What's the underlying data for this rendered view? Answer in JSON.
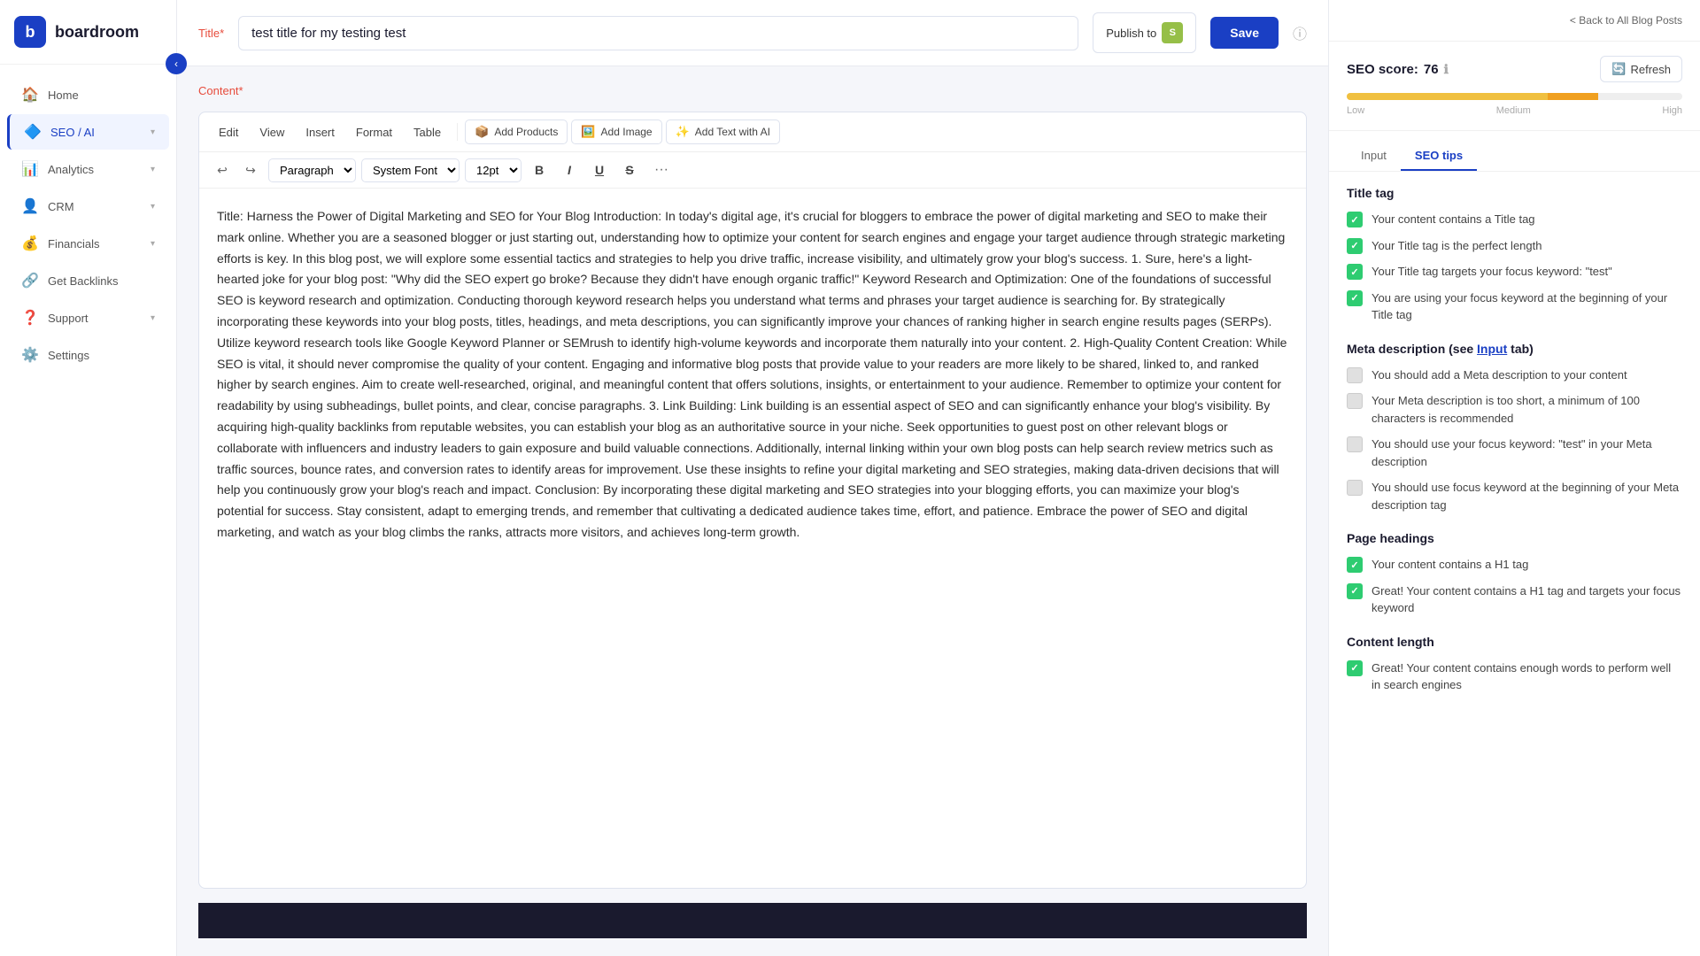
{
  "sidebar": {
    "logo_initial": "b",
    "logo_name": "boardroom",
    "nav_items": [
      {
        "id": "home",
        "label": "Home",
        "icon": "🏠",
        "active": false
      },
      {
        "id": "seo-ai",
        "label": "SEO / AI",
        "icon": "🔷",
        "active": true,
        "has_chevron": true
      },
      {
        "id": "analytics",
        "label": "Analytics",
        "icon": "📊",
        "active": false,
        "has_chevron": true
      },
      {
        "id": "crm",
        "label": "CRM",
        "icon": "👤",
        "active": false,
        "has_chevron": true
      },
      {
        "id": "financials",
        "label": "Financials",
        "icon": "💰",
        "active": false,
        "has_chevron": true
      },
      {
        "id": "backlinks",
        "label": "Get Backlinks",
        "icon": "🔗",
        "active": false
      },
      {
        "id": "support",
        "label": "Support",
        "icon": "❓",
        "active": false,
        "has_chevron": true
      },
      {
        "id": "settings",
        "label": "Settings",
        "icon": "⚙️",
        "active": false
      }
    ]
  },
  "top_bar": {
    "title_label": "Title*",
    "title_value": "test title for my testing test",
    "publish_label": "Publish to",
    "save_label": "Save",
    "back_link": "< Back to All Blog Posts"
  },
  "editor": {
    "content_label": "Content*",
    "toolbar_menus": [
      "Edit",
      "View",
      "Insert",
      "Format",
      "Table"
    ],
    "toolbar_buttons": [
      {
        "id": "add-products",
        "label": "Add Products",
        "icon": "📦"
      },
      {
        "id": "add-image",
        "label": "Add Image",
        "icon": "🖼️"
      },
      {
        "id": "add-text-ai",
        "label": "Add Text with AI",
        "icon": "✨"
      }
    ],
    "format_paragraph": "Paragraph",
    "format_font": "System Font",
    "format_size": "12pt",
    "content": "Title: Harness the Power of Digital Marketing and SEO for Your Blog Introduction: In today's digital age, it's crucial for bloggers to embrace the power of digital marketing and SEO to make their mark online. Whether you are a seasoned blogger or just starting out, understanding how to optimize your content for search engines and engage your target audience through strategic marketing efforts is key. In this blog post, we will explore some essential tactics and strategies to help you drive traffic, increase visibility, and ultimately grow your blog's success. 1.\n\nSure, here's a light-hearted joke for your blog post: \"Why did the SEO expert go broke? Because they didn't have enough organic traffic!\"\n\n Keyword Research and Optimization: One of the foundations of successful SEO is keyword research and optimization. Conducting thorough keyword research helps you understand what terms and phrases your target audience is searching for. By strategically incorporating these keywords into your blog posts, titles, headings, and meta descriptions, you can significantly improve your chances of ranking higher in search engine results pages (SERPs). Utilize keyword research tools like Google Keyword Planner or SEMrush to identify high-volume keywords and incorporate them naturally into your content. 2. High-Quality Content Creation: While SEO is vital, it should never compromise the quality of your content. Engaging and informative blog posts that provide value to your readers are more likely to be shared, linked to, and ranked higher by search engines. Aim to create well-researched, original, and meaningful content that offers solutions, insights, or entertainment to your audience. Remember to optimize your content for readability by using subheadings, bullet points, and clear, concise paragraphs. 3. Link Building: Link building is an essential aspect of SEO and can significantly enhance your blog's visibility. By acquiring high-quality backlinks from reputable websites, you can establish your blog as an authoritative source in your niche. Seek opportunities to guest post on other relevant blogs or collaborate with influencers and industry leaders to gain exposure and build valuable connections. Additionally, internal linking within your own blog posts can help search review metrics such as traffic sources, bounce rates, and conversion rates to identify areas for improvement. Use these insights to refine your digital marketing and SEO strategies, making data-driven decisions that will help you continuously grow your blog's reach and impact. Conclusion: By incorporating these digital marketing and SEO strategies into your blogging efforts, you can maximize your blog's potential for success. Stay consistent, adapt to emerging trends, and remember that cultivating a dedicated audience takes time, effort, and patience. Embrace the power of SEO and digital marketing, and watch as your blog climbs the ranks, attracts more visitors, and achieves long-term growth."
  },
  "seo_panel": {
    "score_label": "SEO score:",
    "score_value": "76",
    "info_icon": "ℹ",
    "score_bar_low": "Low",
    "score_bar_medium": "Medium",
    "score_bar_high": "High",
    "refresh_label": "Refresh",
    "tab_input": "Input",
    "tab_seo_tips": "SEO tips",
    "active_tab": "seo_tips",
    "sections": {
      "title_tag": {
        "title": "Title tag",
        "checks": [
          {
            "id": "has-title-tag",
            "status": "green",
            "text": "Your content contains a Title tag"
          },
          {
            "id": "title-perfect-length",
            "status": "green",
            "text": "Your Title tag is the perfect length"
          },
          {
            "id": "title-targets-keyword",
            "status": "green",
            "text": "Your Title tag targets your focus keyword: \"test\""
          },
          {
            "id": "title-keyword-beginning",
            "status": "green",
            "text": "You are using your focus keyword at the beginning of your Title tag"
          }
        ]
      },
      "meta_description": {
        "title": "Meta description (see Input tab)",
        "link_text": "Input",
        "checks": [
          {
            "id": "add-meta-description",
            "status": "gray",
            "text": "You should add a Meta description to your content"
          },
          {
            "id": "meta-too-short",
            "status": "gray",
            "text": "Your Meta description is too short, a minimum of 100 characters is recommended"
          },
          {
            "id": "meta-focus-keyword",
            "status": "gray",
            "text": "You should use your focus keyword: \"test\" in your Meta description"
          },
          {
            "id": "meta-keyword-beginning",
            "status": "gray",
            "text": "You should use focus keyword at the beginning of your Meta description tag"
          }
        ]
      },
      "page_headings": {
        "title": "Page headings",
        "checks": [
          {
            "id": "h1-tag",
            "status": "green",
            "text": "Your content contains a H1 tag"
          },
          {
            "id": "h1-focus-keyword",
            "status": "green",
            "text": "Great! Your content contains a H1 tag and targets your focus keyword"
          }
        ]
      },
      "content_length": {
        "title": "Content length",
        "checks": [
          {
            "id": "enough-words",
            "status": "green",
            "text": "Great! Your content contains enough words to perform well in search engines"
          }
        ]
      }
    }
  }
}
